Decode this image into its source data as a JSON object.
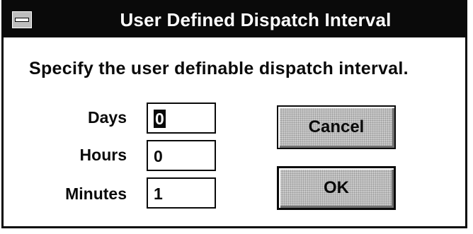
{
  "window": {
    "title": "User Defined Dispatch Interval",
    "system_menu_icon": "system-menu-icon"
  },
  "instruction": "Specify the user definable dispatch interval.",
  "fields": {
    "days": {
      "label": "Days",
      "value": "0"
    },
    "hours": {
      "label": "Hours",
      "value": "0"
    },
    "minutes": {
      "label": "Minutes",
      "value": "1"
    }
  },
  "buttons": {
    "cancel": "Cancel",
    "ok": "OK"
  },
  "colors": {
    "title_bar": "#0a0a0a",
    "button_face": "#c9c9c9",
    "background": "#ffffff"
  }
}
